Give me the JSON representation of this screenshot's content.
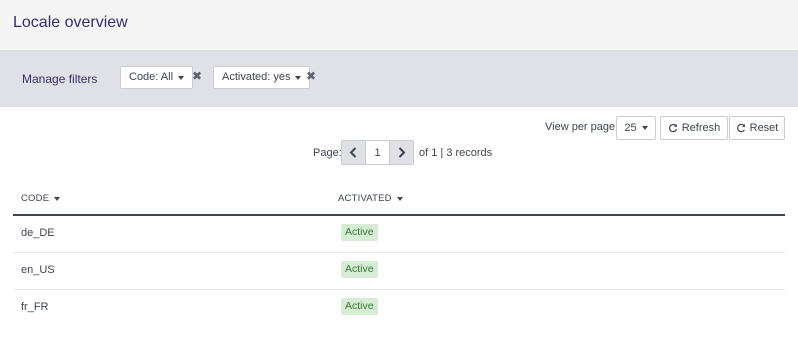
{
  "header": {
    "title": "Locale overview"
  },
  "filters": {
    "manage_label": "Manage filters",
    "items": [
      {
        "label": "Code: All"
      },
      {
        "label": "Activated: yes"
      }
    ],
    "remove_glyph": "✖"
  },
  "toolbar": {
    "view_per_page_label": "View per page:",
    "view_per_page_value": "25",
    "refresh_label": "Refresh",
    "reset_label": "Reset"
  },
  "pagination": {
    "page_label": "Page:",
    "current_page": "1",
    "summary": "of 1 | 3 records"
  },
  "table": {
    "columns": [
      {
        "label": "CODE"
      },
      {
        "label": "ACTIVATED"
      }
    ],
    "rows": [
      {
        "code": "de_DE",
        "status": "Active"
      },
      {
        "code": "en_US",
        "status": "Active"
      },
      {
        "code": "fr_FR",
        "status": "Active"
      }
    ]
  },
  "colors": {
    "title": "#3b2d6b",
    "filter_bar": "#dfe1e6",
    "active_badge_bg": "#d6ecd4",
    "active_badge_text": "#3d7a3a"
  },
  "icons": [
    "chevron-left-icon",
    "chevron-right-icon",
    "refresh-icon",
    "reset-icon",
    "caret-down-icon",
    "remove-icon"
  ]
}
